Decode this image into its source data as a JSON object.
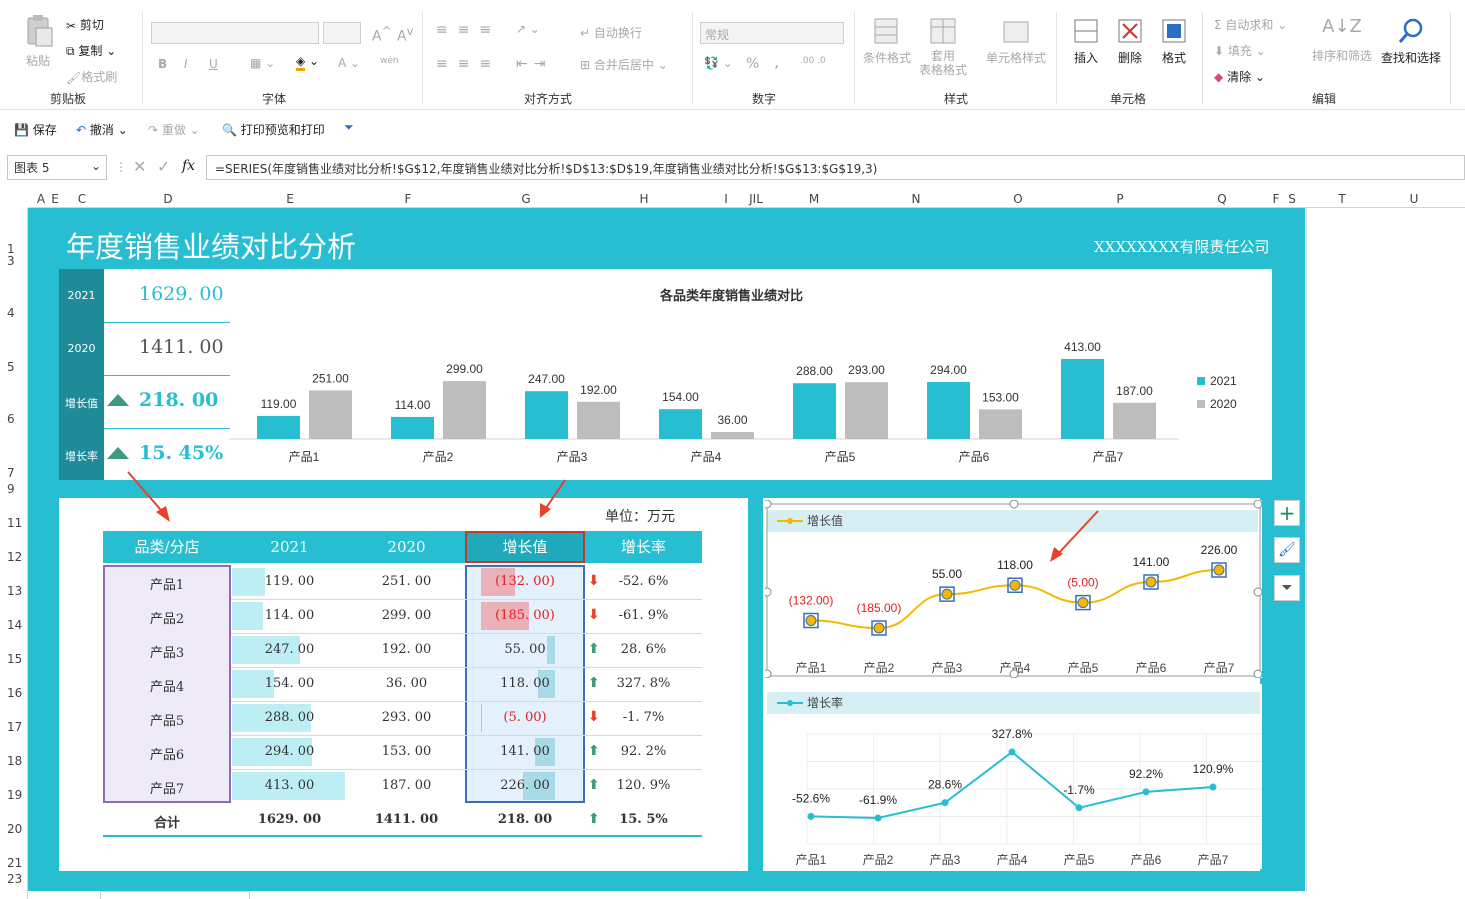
{
  "ribbon": {
    "clipboard": {
      "paste": "粘贴",
      "cut": "剪切",
      "copy": "复制",
      "format_painter": "格式刷",
      "label": "剪贴板"
    },
    "font": {
      "label": "字体",
      "bold": "B",
      "italic": "I",
      "underline": "U",
      "pinyin": "wén"
    },
    "alignment": {
      "wrap": "自动换行",
      "merge": "合并后居中",
      "label": "对齐方式"
    },
    "number": {
      "format": "常规",
      "percent": "%",
      "comma": ",",
      "label": "数字"
    },
    "styles": {
      "conditional": "条件格式",
      "table_format_1": "套用",
      "table_format_2": "表格格式",
      "cell_styles": "单元格样式",
      "label": "样式"
    },
    "cells": {
      "insert": "插入",
      "delete": "删除",
      "format": "格式",
      "label": "单元格"
    },
    "editing": {
      "autosum": "自动求和",
      "fill": "填充",
      "clear": "清除",
      "sort": "排序和筛选",
      "find": "查找和选择",
      "label": "编辑"
    }
  },
  "qat": {
    "save": "保存",
    "undo": "撤消",
    "redo": "重做",
    "print": "打印预览和打印"
  },
  "formula_bar": {
    "name_box": "图表 5",
    "fx": "fx",
    "formula": "=SERIES(年度销售业绩对比分析!$G$12,年度销售业绩对比分析!$D$13:$D$19,年度销售业绩对比分析!$G$13:$G$19,3)"
  },
  "columns": [
    "A",
    "E",
    "C",
    "D",
    "E",
    "F",
    "G",
    "H",
    "I",
    "JIL",
    "M",
    "N",
    "O",
    "P",
    "Q",
    "F",
    "S",
    "T",
    "U"
  ],
  "rows": [
    "1",
    "3",
    "4",
    "5",
    "6",
    "7",
    "9",
    "11",
    "12",
    "13",
    "14",
    "15",
    "16",
    "17",
    "18",
    "19",
    "20",
    "21",
    "23"
  ],
  "dashboard": {
    "title": "年度销售业绩对比分析",
    "company": "XXXXXXXX有限责任公司",
    "kpi": [
      {
        "label": "2021",
        "value": "1629. 00"
      },
      {
        "label": "2020",
        "value": "1411. 00"
      },
      {
        "label": "增长值",
        "value": "218. 00"
      },
      {
        "label": "增长率",
        "value": "15. 45%"
      }
    ],
    "unit": "单位：万元",
    "table": {
      "headers": [
        "品类/分店",
        "2021",
        "2020",
        "增长值",
        "增长率"
      ],
      "rows": [
        {
          "name": "产品1",
          "y2021": "119. 00",
          "y2020": "251. 00",
          "growth": "(132. 00)",
          "rate": "-52. 6%"
        },
        {
          "name": "产品2",
          "y2021": "114. 00",
          "y2020": "299. 00",
          "growth": "(185. 00)",
          "rate": "-61. 9%"
        },
        {
          "name": "产品3",
          "y2021": "247. 00",
          "y2020": "192. 00",
          "growth": "55. 00",
          "rate": "28. 6%"
        },
        {
          "name": "产品4",
          "y2021": "154. 00",
          "y2020": "36. 00",
          "growth": "118. 00",
          "rate": "327. 8%"
        },
        {
          "name": "产品5",
          "y2021": "288. 00",
          "y2020": "293. 00",
          "growth": "(5. 00)",
          "rate": "-1. 7%"
        },
        {
          "name": "产品6",
          "y2021": "294. 00",
          "y2020": "153. 00",
          "growth": "141. 00",
          "rate": "92. 2%"
        },
        {
          "name": "产品7",
          "y2021": "413. 00",
          "y2020": "187. 00",
          "growth": "226. 00",
          "rate": "120. 9%"
        }
      ],
      "total": {
        "name": "合计",
        "y2021": "1629. 00",
        "y2020": "1411. 00",
        "growth": "218. 00",
        "rate": "15. 5%"
      }
    }
  },
  "colors": {
    "teal": "#28bed1",
    "dark_teal": "#1f8b99",
    "gray": "#bdbdbd",
    "orange": "#f5b800",
    "red_arrow": "#e8412c",
    "green_arrow": "#3d9a7d"
  },
  "chart_data": [
    {
      "type": "bar",
      "title": "各品类年度销售业绩对比",
      "categories": [
        "产品1",
        "产品2",
        "产品3",
        "产品4",
        "产品5",
        "产品6",
        "产品7"
      ],
      "series": [
        {
          "name": "2021",
          "values": [
            119,
            114,
            247,
            154,
            288,
            294,
            413
          ],
          "labels": [
            "119.00",
            "114.00",
            "247.00",
            "154.00",
            "288.00",
            "294.00",
            "413.00"
          ]
        },
        {
          "name": "2020",
          "values": [
            251,
            299,
            192,
            36,
            293,
            153,
            187
          ],
          "labels": [
            "251.00",
            "299.00",
            "192.00",
            "36.00",
            "293.00",
            "153.00",
            "187.00"
          ]
        }
      ],
      "legend": "right",
      "grid": false
    },
    {
      "type": "line",
      "categories": [
        "产品1",
        "产品2",
        "产品3",
        "产品4",
        "产品5",
        "产品6",
        "产品7"
      ],
      "series": [
        {
          "name": "增长值",
          "values": [
            -132,
            -185,
            55,
            118,
            -5,
            141,
            226
          ],
          "labels": [
            "(132.00)",
            "(185.00)",
            "55.00",
            "118.00",
            "(5.00)",
            "141.00",
            "226.00"
          ]
        }
      ],
      "legend": "top-left",
      "grid": false
    },
    {
      "type": "line",
      "categories": [
        "产品1",
        "产品2",
        "产品3",
        "产品4",
        "产品5",
        "产品6",
        "产品7"
      ],
      "series": [
        {
          "name": "增长率",
          "values": [
            -52.6,
            -61.9,
            28.6,
            327.8,
            -1.7,
            92.2,
            120.9
          ],
          "labels": [
            "-52.6%",
            "-61.9%",
            "28.6%",
            "327.8%",
            "-1.7%",
            "92.2%",
            "120.9%"
          ]
        }
      ],
      "legend": "top-left",
      "grid": true
    }
  ]
}
